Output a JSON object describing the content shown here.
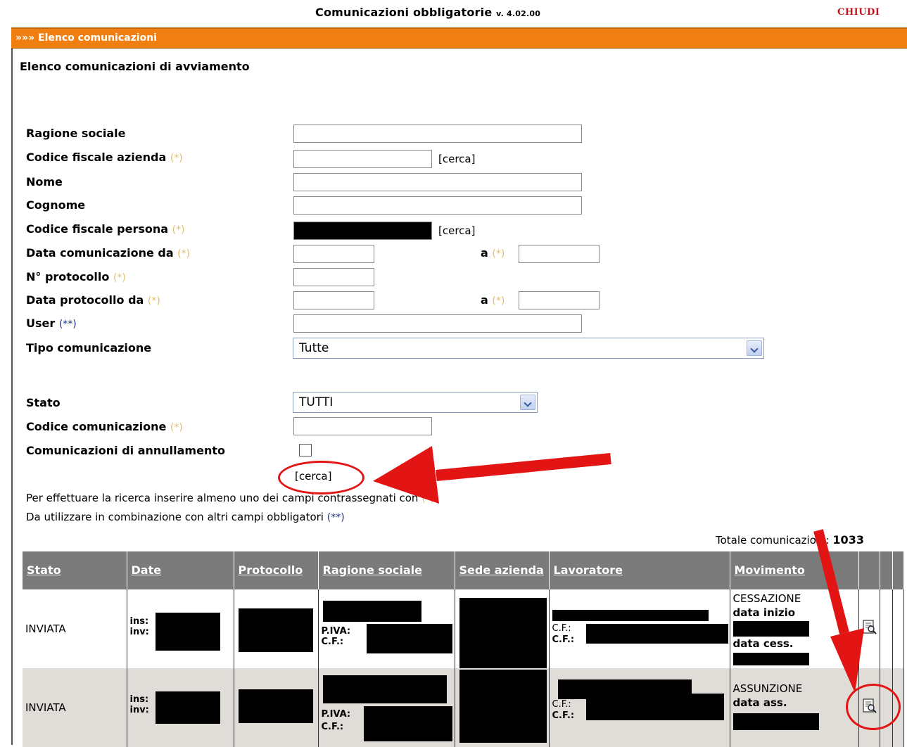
{
  "app": {
    "title": "Comunicazioni obbligatorie",
    "version": "v. 4.02.00",
    "close_label": "CHIUDI"
  },
  "section": {
    "title": "»»» Elenco comunicazioni"
  },
  "page": {
    "title": "Elenco comunicazioni di avviamento"
  },
  "form": {
    "ragione_sociale": "Ragione sociale",
    "cf_azienda": "Codice fiscale azienda",
    "nome": "Nome",
    "cognome": "Cognome",
    "cf_persona": "Codice fiscale persona",
    "data_comunicazione_da": "Data comunicazione da",
    "protocollo": "N° protocollo",
    "data_protocollo_da": "Data protocollo da",
    "user": "User",
    "tipo_comunicazione": "Tipo comunicazione",
    "stato": "Stato",
    "codice_comunicazione": "Codice comunicazione",
    "annullamento": "Comunicazioni di annullamento",
    "a_label": "a",
    "req_marker": "(*)",
    "req2_marker": "(**)",
    "cerca": "[cerca]",
    "tipo_value": "Tutte",
    "stato_value": "TUTTI"
  },
  "help": {
    "line1": "Per effettuare la ricerca inserire almeno uno dei campi contrassegnati con",
    "line2": "Da utilizzare in combinazione con altri campi obbligatori"
  },
  "totals": {
    "label": "Totale comunicazioni:",
    "value": "1033"
  },
  "table": {
    "headers": [
      "Stato",
      "Date",
      "Protocollo",
      "Ragione sociale",
      "Sede azienda",
      "Lavoratore",
      "Movimento"
    ],
    "row_labels": {
      "ins": "ins:",
      "inv": "inv:",
      "piva": "P.IVA:",
      "cf": "C.F.:"
    },
    "rows": [
      {
        "stato": "INVIATA",
        "movimento": "CESSAZIONE",
        "m1": "data inizio",
        "m2": "data cess."
      },
      {
        "stato": "INVIATA",
        "movimento": "ASSUNZIONE",
        "m1": "data ass.",
        "m2": ""
      }
    ]
  },
  "colors": {
    "accent_orange": "#f07e10",
    "header_gray": "#7a7a7a",
    "annotation_red": "#e21414"
  },
  "icons": [
    "detail-view-icon"
  ]
}
